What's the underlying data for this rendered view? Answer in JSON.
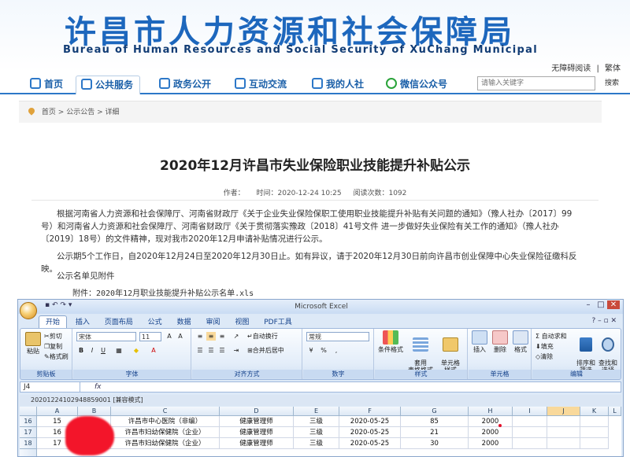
{
  "header": {
    "title_cn": "许昌市人力资源和社会保障局",
    "title_en": "Bureau of Human Resources and Social Security of XuChang Municipal",
    "links": [
      "无障碍阅读",
      "|",
      "繁体"
    ]
  },
  "nav": {
    "items": [
      {
        "label": "首页",
        "icon": "home-icon"
      },
      {
        "label": "公共服务",
        "icon": "service-icon"
      },
      {
        "label": "政务公开",
        "icon": "document-icon"
      },
      {
        "label": "互动交流",
        "icon": "chat-icon"
      },
      {
        "label": "我的人社",
        "icon": "user-icon"
      },
      {
        "label": "微信公众号",
        "icon": "wechat-icon"
      }
    ],
    "search_placeholder": "请输入关键字",
    "search_button": "搜索"
  },
  "breadcrumb": [
    "首页",
    ">",
    "公示公告",
    ">",
    "详细"
  ],
  "article": {
    "title": "2020年12月许昌市失业保险职业技能提升补贴公示",
    "author_label": "作者：",
    "time_label": "时间：2020-12-24 10:25",
    "views_label": "阅读次数：1092",
    "p1": "根据河南省人力资源和社会保障厅、河南省财政厅《关于企业失业保险保职工使用职业技能提升补贴有关问题的通知》（豫人社办〔2017〕99号）和河南省人力资源和社会保障厅、河南省财政厅《关于贯彻落实豫政〔2018〕41号文件 进一步做好失业保险有关工作的通知》（豫人社办〔2019〕18号）的文件精神，现对我市2020年12月申请补贴情况进行公示。",
    "p2": "公示期5个工作日，自2020年12月24日至2020年12月30日止。如有异议，请于2020年12月30日前向许昌市创业保障中心失业保险征缴科反映。",
    "p3": "公示名单见附件",
    "p4": "附件：2020年12月职业技能提升补贴公示名单.xls"
  },
  "excel": {
    "app_title": "Microsoft Excel",
    "tabs": [
      "开始",
      "插入",
      "页面布局",
      "公式",
      "数据",
      "审阅",
      "视图",
      "PDF工具"
    ],
    "clipboard": {
      "paste": "粘贴",
      "cut": "剪切",
      "copy": "复制",
      "format_painter": "格式刷",
      "label": "剪贴板"
    },
    "font": {
      "name": "宋体",
      "size": "11",
      "label": "字体",
      "bold": "B",
      "italic": "I",
      "underline": "U"
    },
    "alignment": {
      "wrap": "自动换行",
      "merge": "合并后居中",
      "label": "对齐方式"
    },
    "number": {
      "format": "常规",
      "percent": "%",
      "comma": ",",
      "label": "数字"
    },
    "styles": {
      "conditional": "条件格式",
      "table": "套用\n表格格式",
      "cell": "单元格\n样式",
      "label": "样式"
    },
    "cells": {
      "insert": "插入",
      "delete": "删除",
      "format": "格式",
      "label": "单元格"
    },
    "editing": {
      "autosum": "Σ 自动求和",
      "fill": "填充",
      "clear": "清除",
      "sort": "排序和\n筛选",
      "find": "查找和\n选择",
      "label": "编辑"
    },
    "name_box": "J4",
    "fx": "fx",
    "book_tab": "20201224102948859001  [兼容模式]",
    "columns": [
      "A",
      "B",
      "C",
      "D",
      "E",
      "F",
      "G",
      "H",
      "I",
      "J",
      "K",
      "L"
    ],
    "rows": [
      {
        "row": "16",
        "cells": [
          "15",
          "",
          "许昌市中心医院（非编）",
          "健康管理师",
          "三级",
          "2020-05-25",
          "85",
          "2000"
        ]
      },
      {
        "row": "17",
        "cells": [
          "16",
          "",
          "许昌市妇幼保健院（企业）",
          "健康管理师",
          "三级",
          "2020-05-25",
          "21",
          "2000"
        ]
      },
      {
        "row": "18",
        "cells": [
          "17",
          "",
          "许昌市妇幼保健院（企业）",
          "健康管理师",
          "三级",
          "2020-05-25",
          "30",
          "2000"
        ]
      }
    ]
  }
}
